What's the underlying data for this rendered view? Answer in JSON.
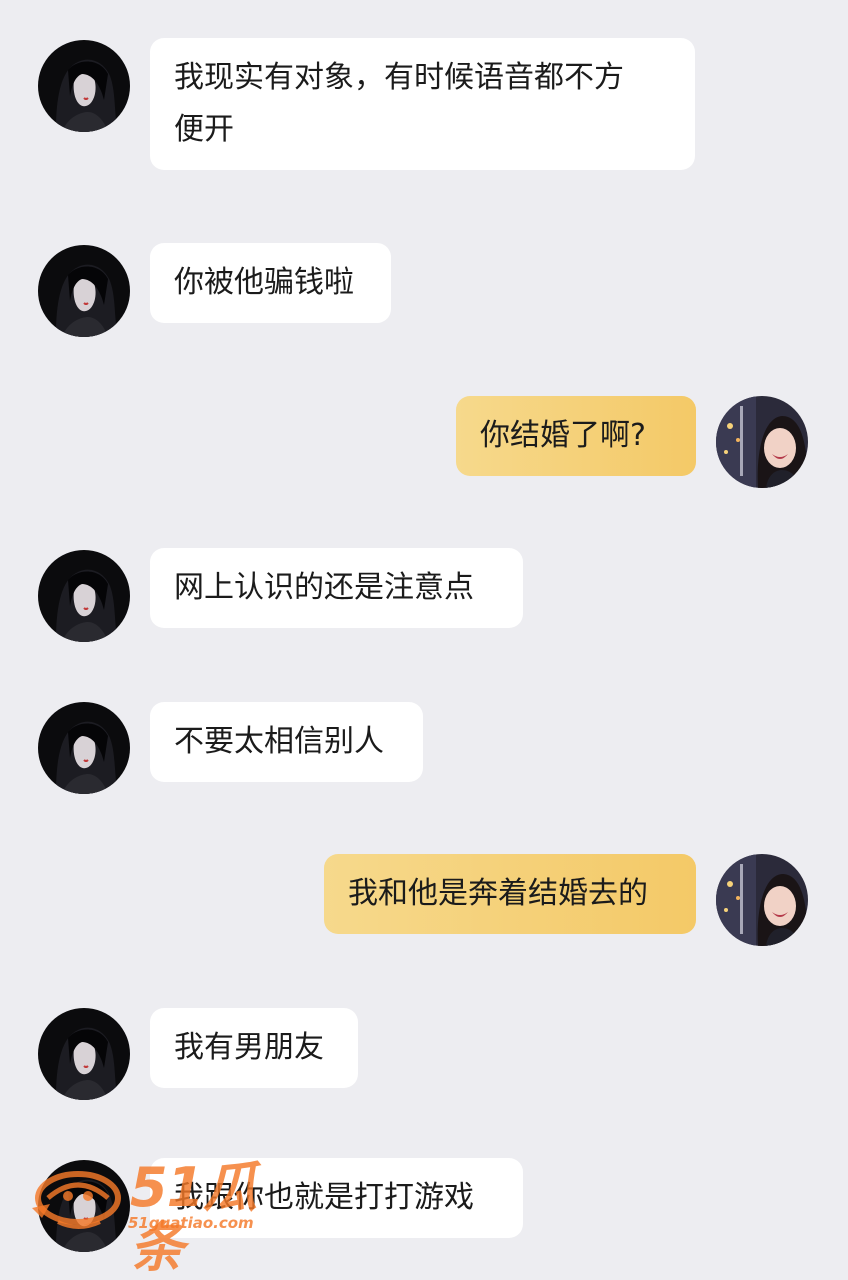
{
  "colors": {
    "background": "#ededf1",
    "incoming_bubble": "#ffffff",
    "outgoing_bubble": "#f5cf72",
    "watermark": "#f47928"
  },
  "messages": [
    {
      "side": "left",
      "avatar": "dark-hair-girl-avatar",
      "text": "我现实有对象，有时候语音都不方\n便开"
    },
    {
      "side": "left",
      "avatar": "dark-hair-girl-avatar",
      "text": "你被他骗钱啦"
    },
    {
      "side": "right",
      "avatar": "smiling-girl-avatar",
      "text": "你结婚了啊?"
    },
    {
      "side": "left",
      "avatar": "dark-hair-girl-avatar",
      "text": "网上认识的还是注意点"
    },
    {
      "side": "left",
      "avatar": "dark-hair-girl-avatar",
      "text": "不要太相信别人"
    },
    {
      "side": "right",
      "avatar": "smiling-girl-avatar",
      "text": "我和他是奔着结婚去的"
    },
    {
      "side": "left",
      "avatar": "dark-hair-girl-avatar",
      "text": "我有男朋友"
    },
    {
      "side": "left",
      "avatar": "dark-hair-girl-avatar",
      "text": "我跟你也就是打打游戏"
    }
  ],
  "watermark": {
    "brand": "51瓜条",
    "url": "51guatiao.com",
    "icon": "melon-logo-icon"
  }
}
